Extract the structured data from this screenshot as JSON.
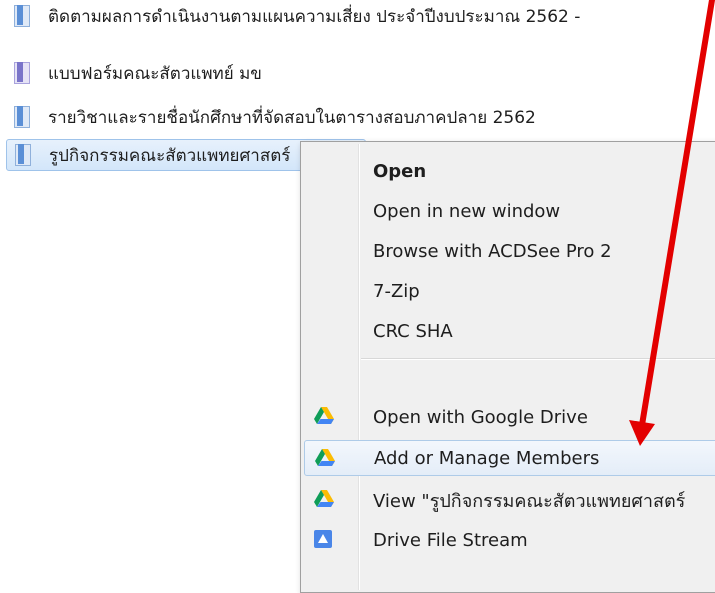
{
  "files": [
    {
      "name": "ติดตามผลการดำเนินงานตามแผนความเสี่ยง ประจำปีงบประมาณ 2562 -",
      "icon": "folder-ribbon-icon"
    },
    {
      "name": "แบบฟอร์มคณะสัตวแพทย์ มข",
      "icon": "folder-ribbon-icon"
    },
    {
      "name": "รายวิชาและรายชื่อนักศึกษาที่จัดสอบในตารางสอบภาคปลาย 2562",
      "icon": "folder-ribbon-icon"
    },
    {
      "name": "รูปกิจกรรมคณะสัตวแพทยศาสตร์",
      "icon": "folder-ribbon-icon"
    }
  ],
  "context_menu": {
    "items": [
      {
        "label": "Open",
        "bold": true
      },
      {
        "label": "Open in new window"
      },
      {
        "label": "Browse with ACDSee Pro 2"
      },
      {
        "label": "7-Zip"
      },
      {
        "label": "CRC SHA"
      },
      {
        "label": "Open with Google Drive",
        "icon": "google-drive-icon"
      },
      {
        "label": "Add or Manage Members",
        "icon": "google-drive-icon",
        "highlighted": true
      },
      {
        "label": "View \"รูปกิจกรรมคณะสัตวแพทยศาสตร์",
        "icon": "google-drive-icon"
      },
      {
        "label": "Drive File Stream",
        "icon": "drive-file-stream-icon"
      }
    ]
  },
  "annotation": {
    "color": "#e30000",
    "shape": "arrow"
  }
}
